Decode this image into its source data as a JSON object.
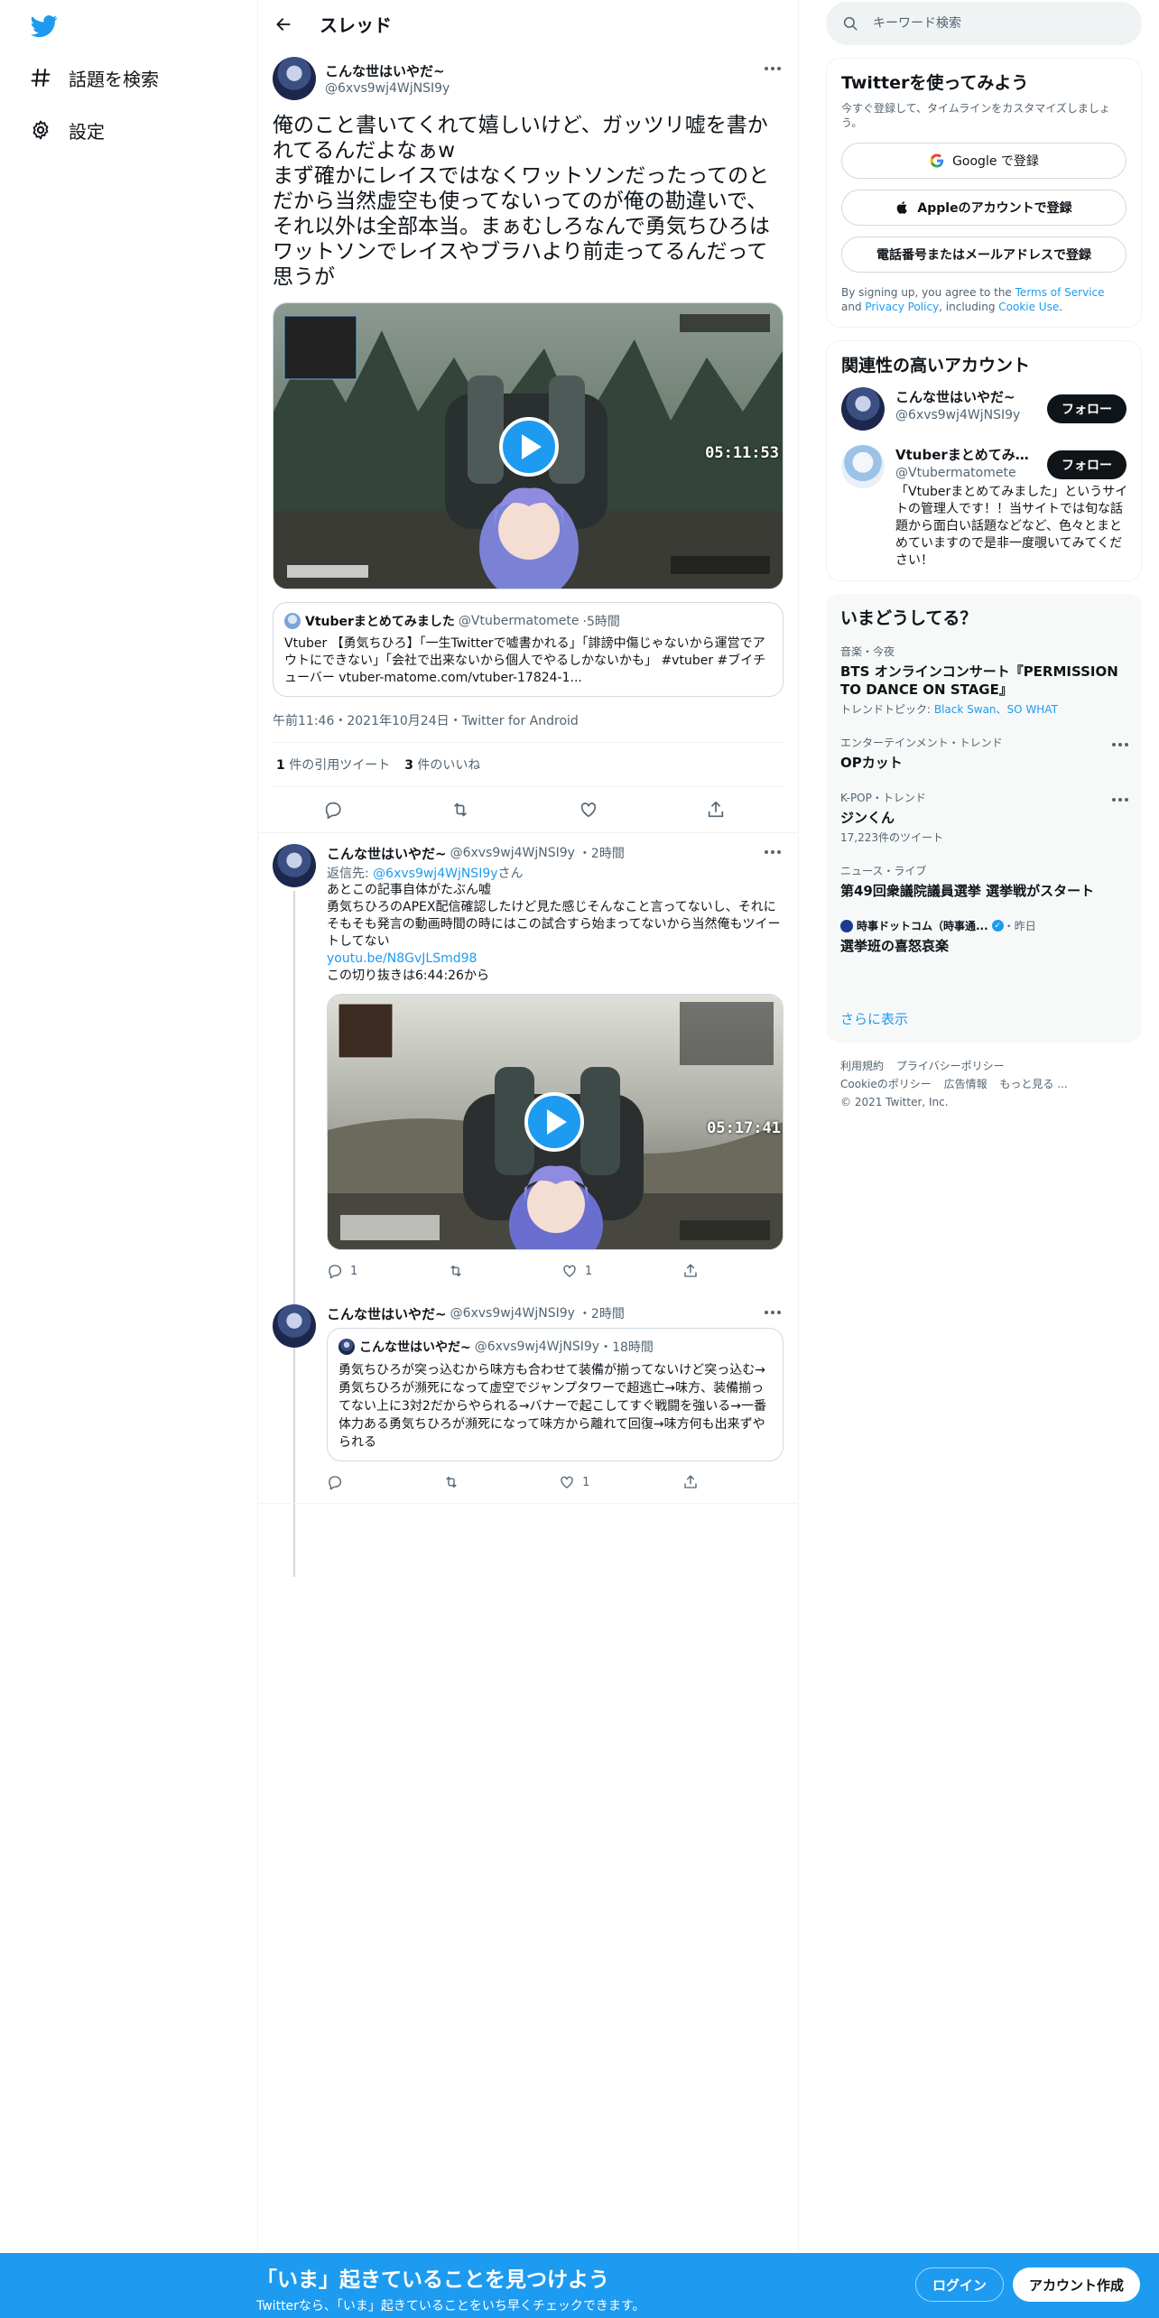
{
  "nav": {
    "explore_label": "話題を検索",
    "settings_label": "設定"
  },
  "header": {
    "title": "スレッド"
  },
  "main_tweet": {
    "name": "こんな世はいやだ~",
    "handle": "@6xvs9wj4WjNSI9y",
    "text": "俺のこと書いてくれて嬉しいけど、ガッツリ嘘を書かれてるんだよなぁw\nまず確かにレイスではなくワットソンだったってのとだから当然虚空も使ってないってのが俺の勘違いで、それ以外は全部本当。まぁむしろなんで勇気ちひろはワットソンでレイスやブラハより前走ってるんだって思うが",
    "video_time": "05:11:53",
    "quote": {
      "name": "Vtuberまとめてみました",
      "handle": "@Vtubermatomete",
      "time": "5時間",
      "text": "Vtuber 【勇気ちひろ】「一生Twitterで嘘書かれる」「誹謗中傷じゃないから運営でアウトにできない」「会社で出来ないから個人でやるしかないかも」 #vtuber #ブイチューバー vtuber-matome.com/vtuber-17824-1..."
    },
    "meta": "午前11:46・2021年10月24日・Twitter for Android",
    "quote_count": "1",
    "quote_label": "件の引用ツイート",
    "like_count": "3",
    "like_label": "件のいいね"
  },
  "reply1": {
    "name": "こんな世はいやだ~",
    "handle": "@6xvs9wj4WjNSI9y",
    "time": "・2時間",
    "reply_to_prefix": "返信先: ",
    "reply_to_handle": "@6xvs9wj4WjNSI9y",
    "reply_to_suffix": "さん",
    "text": "あとこの記事自体がたぶん嘘\n勇気ちひろのAPEX配信確認したけど見た感じそんなこと言ってないし、それにそもそも発言の動画時間の時にはこの試合すら始まってないから当然俺もツイートしてない",
    "link": "youtu.be/N8GvJLSmd98",
    "text2": "この切り抜きは6:44:26から",
    "video_time": "05:17:41",
    "reply_count": "1",
    "like_count": "1"
  },
  "reply2": {
    "name": "こんな世はいやだ~",
    "handle": "@6xvs9wj4WjNSI9y",
    "time": "・2時間",
    "quote": {
      "name": "こんな世はいやだ~",
      "handle": "@6xvs9wj4WjNSI9y",
      "time": "・18時間",
      "text": "勇気ちひろが突っ込むから味方も合わせて装備が揃ってないけど突っ込む→勇気ちひろが瀕死になって虚空でジャンプタワーで超逃亡→味方、装備揃ってない上に3対2だからやられる→バナーで起こしてすぐ戦闘を強いる→一番体力ある勇気ちひろが瀕死になって味方から離れて回復→味方何も出来ずやられる"
    },
    "like_count": "1"
  },
  "search": {
    "placeholder": "キーワード検索"
  },
  "signup_card": {
    "title": "Twitterを使ってみよう",
    "sub": "今すぐ登録して、タイムラインをカスタマイズしましょう。",
    "google": "Google で登録",
    "apple": "Appleのアカウントで登録",
    "phone": "電話番号またはメールアドレスで登録",
    "terms_pre": "By signing up, you agree to the ",
    "terms_link": "Terms of Service",
    "terms_and": " and ",
    "privacy_link": "Privacy Policy",
    "terms_incl": ", including ",
    "cookie_link": "Cookie Use",
    "terms_end": "."
  },
  "related": {
    "title": "関連性の高いアカウント",
    "follow_label": "フォロー",
    "accounts": [
      {
        "name": "こんな世はいやだ~",
        "handle": "@6xvs9wj4WjNSI9y",
        "bio": ""
      },
      {
        "name": "Vtuberまとめてみま...",
        "handle": "@Vtubermatomete",
        "bio": "「Vtuberまとめてみました」というサイトの管理人です！！当サイトでは旬な話題から面白い話題などなど、色々とまとめていますので是非一度覗いてみてください！"
      }
    ]
  },
  "trends": {
    "title": "いまどうしてる？",
    "items": [
      {
        "cat": "音楽・今夜",
        "title": "BTS オンラインコンサート『PERMISSION TO DANCE ON STAGE』",
        "extra_prefix": "トレンドトピック: ",
        "extra_link": "Black Swan、SO WHAT"
      },
      {
        "cat": "エンターテインメント・トレンド",
        "title": "OPカット"
      },
      {
        "cat": "K-POP・トレンド",
        "title": "ジンくん",
        "extra": "17,223件のツイート"
      },
      {
        "cat": "ニュース・ライブ",
        "title": "第49回衆議院議員選挙 選挙戦がスタート"
      },
      {
        "cat_name": "時事ドットコム（時事通...",
        "cat_time": "・昨日",
        "title": "選挙班の喜怒哀楽"
      }
    ],
    "show_more": "さらに表示"
  },
  "footer": {
    "links": [
      "利用規約",
      "プライバシーポリシー",
      "Cookieのポリシー",
      "広告情報",
      "もっと見る ..."
    ],
    "copyright": "© 2021 Twitter, Inc."
  },
  "bottom_bar": {
    "title": "「いま」起きていることを見つけよう",
    "sub": "Twitterなら、「いま」起きていることをいち早くチェックできます。",
    "login": "ログイン",
    "signup": "アカウント作成"
  },
  "colors": {
    "accent": "#1d9bf0",
    "text": "#0f1419",
    "muted": "#536471",
    "border": "#eff3f4"
  }
}
